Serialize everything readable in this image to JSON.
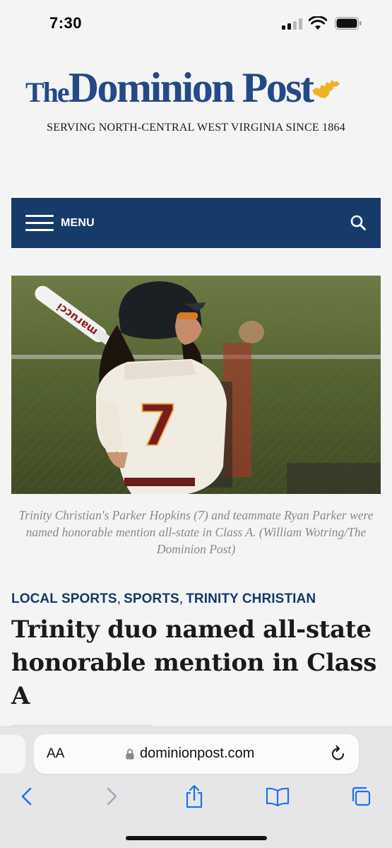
{
  "status_bar": {
    "time": "7:30",
    "signal_icon": "cellular-signal-icon",
    "wifi_icon": "wifi-icon",
    "battery_icon": "battery-icon"
  },
  "masthead": {
    "logo_the": "The",
    "logo_name": "Dominion Post",
    "logo_state_icon": "west-virginia-state-icon",
    "tagline": "SERVING NORTH-CENTRAL WEST VIRGINIA SINCE 1864",
    "brand_color": "#234a86",
    "accent_color": "#f0b323"
  },
  "nav": {
    "menu_label": "MENU",
    "menu_icon": "hamburger-icon",
    "search_icon": "search-icon",
    "bar_color": "#163a6a"
  },
  "article": {
    "photo_caption": "Trinity Christian's Parker Hopkins (7) and teammate Ryan Parker were named honorable mention all-state in Class A. (William Wotring/The Dominion Post)",
    "bat_text": "marucci",
    "jersey_number": "7",
    "categories": [
      "LOCAL SPORTS",
      "SPORTS",
      "TRINITY CHRISTIAN"
    ],
    "category_separator": ",",
    "headline": "Trinity duo named all-state honorable mention in Class A"
  },
  "browser": {
    "text_size_button": "AA",
    "url": "dominionpost.com",
    "lock_icon": "lock-icon",
    "reload_icon": "reload-icon",
    "toolbar_icons": [
      "back-icon",
      "forward-icon",
      "share-icon",
      "bookmarks-icon",
      "tabs-icon"
    ]
  }
}
